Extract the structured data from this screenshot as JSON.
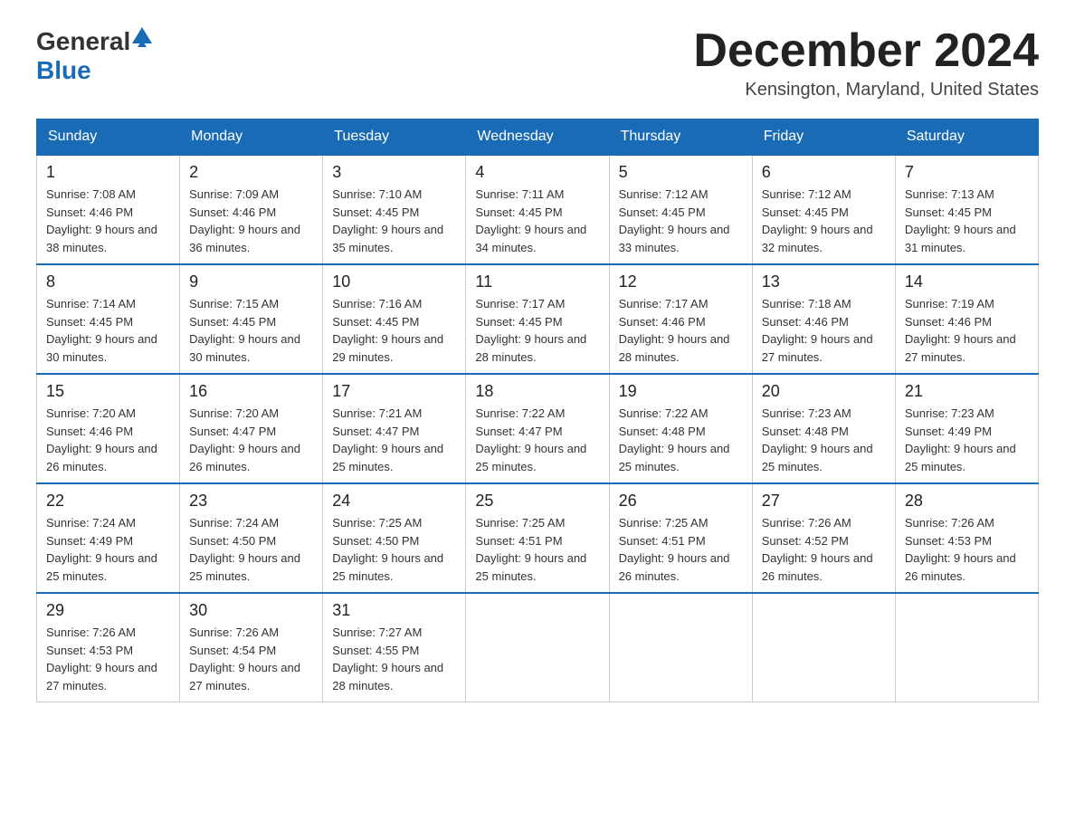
{
  "header": {
    "logo_general": "General",
    "logo_blue": "Blue",
    "title": "December 2024",
    "location": "Kensington, Maryland, United States"
  },
  "weekdays": [
    "Sunday",
    "Monday",
    "Tuesday",
    "Wednesday",
    "Thursday",
    "Friday",
    "Saturday"
  ],
  "weeks": [
    [
      {
        "day": "1",
        "sunrise": "Sunrise: 7:08 AM",
        "sunset": "Sunset: 4:46 PM",
        "daylight": "Daylight: 9 hours and 38 minutes."
      },
      {
        "day": "2",
        "sunrise": "Sunrise: 7:09 AM",
        "sunset": "Sunset: 4:46 PM",
        "daylight": "Daylight: 9 hours and 36 minutes."
      },
      {
        "day": "3",
        "sunrise": "Sunrise: 7:10 AM",
        "sunset": "Sunset: 4:45 PM",
        "daylight": "Daylight: 9 hours and 35 minutes."
      },
      {
        "day": "4",
        "sunrise": "Sunrise: 7:11 AM",
        "sunset": "Sunset: 4:45 PM",
        "daylight": "Daylight: 9 hours and 34 minutes."
      },
      {
        "day": "5",
        "sunrise": "Sunrise: 7:12 AM",
        "sunset": "Sunset: 4:45 PM",
        "daylight": "Daylight: 9 hours and 33 minutes."
      },
      {
        "day": "6",
        "sunrise": "Sunrise: 7:12 AM",
        "sunset": "Sunset: 4:45 PM",
        "daylight": "Daylight: 9 hours and 32 minutes."
      },
      {
        "day": "7",
        "sunrise": "Sunrise: 7:13 AM",
        "sunset": "Sunset: 4:45 PM",
        "daylight": "Daylight: 9 hours and 31 minutes."
      }
    ],
    [
      {
        "day": "8",
        "sunrise": "Sunrise: 7:14 AM",
        "sunset": "Sunset: 4:45 PM",
        "daylight": "Daylight: 9 hours and 30 minutes."
      },
      {
        "day": "9",
        "sunrise": "Sunrise: 7:15 AM",
        "sunset": "Sunset: 4:45 PM",
        "daylight": "Daylight: 9 hours and 30 minutes."
      },
      {
        "day": "10",
        "sunrise": "Sunrise: 7:16 AM",
        "sunset": "Sunset: 4:45 PM",
        "daylight": "Daylight: 9 hours and 29 minutes."
      },
      {
        "day": "11",
        "sunrise": "Sunrise: 7:17 AM",
        "sunset": "Sunset: 4:45 PM",
        "daylight": "Daylight: 9 hours and 28 minutes."
      },
      {
        "day": "12",
        "sunrise": "Sunrise: 7:17 AM",
        "sunset": "Sunset: 4:46 PM",
        "daylight": "Daylight: 9 hours and 28 minutes."
      },
      {
        "day": "13",
        "sunrise": "Sunrise: 7:18 AM",
        "sunset": "Sunset: 4:46 PM",
        "daylight": "Daylight: 9 hours and 27 minutes."
      },
      {
        "day": "14",
        "sunrise": "Sunrise: 7:19 AM",
        "sunset": "Sunset: 4:46 PM",
        "daylight": "Daylight: 9 hours and 27 minutes."
      }
    ],
    [
      {
        "day": "15",
        "sunrise": "Sunrise: 7:20 AM",
        "sunset": "Sunset: 4:46 PM",
        "daylight": "Daylight: 9 hours and 26 minutes."
      },
      {
        "day": "16",
        "sunrise": "Sunrise: 7:20 AM",
        "sunset": "Sunset: 4:47 PM",
        "daylight": "Daylight: 9 hours and 26 minutes."
      },
      {
        "day": "17",
        "sunrise": "Sunrise: 7:21 AM",
        "sunset": "Sunset: 4:47 PM",
        "daylight": "Daylight: 9 hours and 25 minutes."
      },
      {
        "day": "18",
        "sunrise": "Sunrise: 7:22 AM",
        "sunset": "Sunset: 4:47 PM",
        "daylight": "Daylight: 9 hours and 25 minutes."
      },
      {
        "day": "19",
        "sunrise": "Sunrise: 7:22 AM",
        "sunset": "Sunset: 4:48 PM",
        "daylight": "Daylight: 9 hours and 25 minutes."
      },
      {
        "day": "20",
        "sunrise": "Sunrise: 7:23 AM",
        "sunset": "Sunset: 4:48 PM",
        "daylight": "Daylight: 9 hours and 25 minutes."
      },
      {
        "day": "21",
        "sunrise": "Sunrise: 7:23 AM",
        "sunset": "Sunset: 4:49 PM",
        "daylight": "Daylight: 9 hours and 25 minutes."
      }
    ],
    [
      {
        "day": "22",
        "sunrise": "Sunrise: 7:24 AM",
        "sunset": "Sunset: 4:49 PM",
        "daylight": "Daylight: 9 hours and 25 minutes."
      },
      {
        "day": "23",
        "sunrise": "Sunrise: 7:24 AM",
        "sunset": "Sunset: 4:50 PM",
        "daylight": "Daylight: 9 hours and 25 minutes."
      },
      {
        "day": "24",
        "sunrise": "Sunrise: 7:25 AM",
        "sunset": "Sunset: 4:50 PM",
        "daylight": "Daylight: 9 hours and 25 minutes."
      },
      {
        "day": "25",
        "sunrise": "Sunrise: 7:25 AM",
        "sunset": "Sunset: 4:51 PM",
        "daylight": "Daylight: 9 hours and 25 minutes."
      },
      {
        "day": "26",
        "sunrise": "Sunrise: 7:25 AM",
        "sunset": "Sunset: 4:51 PM",
        "daylight": "Daylight: 9 hours and 26 minutes."
      },
      {
        "day": "27",
        "sunrise": "Sunrise: 7:26 AM",
        "sunset": "Sunset: 4:52 PM",
        "daylight": "Daylight: 9 hours and 26 minutes."
      },
      {
        "day": "28",
        "sunrise": "Sunrise: 7:26 AM",
        "sunset": "Sunset: 4:53 PM",
        "daylight": "Daylight: 9 hours and 26 minutes."
      }
    ],
    [
      {
        "day": "29",
        "sunrise": "Sunrise: 7:26 AM",
        "sunset": "Sunset: 4:53 PM",
        "daylight": "Daylight: 9 hours and 27 minutes."
      },
      {
        "day": "30",
        "sunrise": "Sunrise: 7:26 AM",
        "sunset": "Sunset: 4:54 PM",
        "daylight": "Daylight: 9 hours and 27 minutes."
      },
      {
        "day": "31",
        "sunrise": "Sunrise: 7:27 AM",
        "sunset": "Sunset: 4:55 PM",
        "daylight": "Daylight: 9 hours and 28 minutes."
      },
      null,
      null,
      null,
      null
    ]
  ]
}
